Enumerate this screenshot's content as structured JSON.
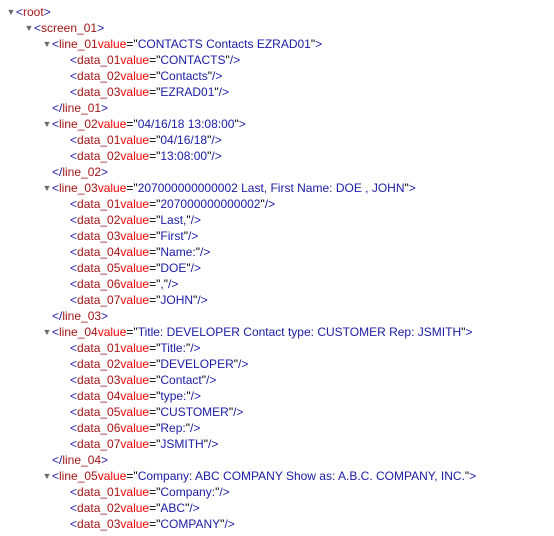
{
  "icons": {
    "open": "▼",
    "closed": "▶",
    "attr_sep": "="
  },
  "tree": [
    {
      "depth": 0,
      "twisty": "open",
      "kind": "open",
      "tag": "root"
    },
    {
      "depth": 1,
      "twisty": "open",
      "kind": "open",
      "tag": "screen_01"
    },
    {
      "depth": 2,
      "twisty": "open",
      "kind": "open",
      "tag": "line_01",
      "attr": "value",
      "val": " CONTACTS Contacts EZRAD01"
    },
    {
      "depth": 3,
      "twisty": "blank",
      "kind": "self",
      "tag": "data_01",
      "attr": "value",
      "val": "CONTACTS"
    },
    {
      "depth": 3,
      "twisty": "blank",
      "kind": "self",
      "tag": "data_02",
      "attr": "value",
      "val": "Contacts"
    },
    {
      "depth": 3,
      "twisty": "blank",
      "kind": "self",
      "tag": "data_03",
      "attr": "value",
      "val": "EZRAD01"
    },
    {
      "depth": 2,
      "twisty": "blank",
      "kind": "close",
      "tag": "line_01"
    },
    {
      "depth": 2,
      "twisty": "open",
      "kind": "open",
      "tag": "line_02",
      "attr": "value",
      "val": " 04/16/18 13:08:00"
    },
    {
      "depth": 3,
      "twisty": "blank",
      "kind": "self",
      "tag": "data_01",
      "attr": "value",
      "val": "04/16/18"
    },
    {
      "depth": 3,
      "twisty": "blank",
      "kind": "self",
      "tag": "data_02",
      "attr": "value",
      "val": "13:08:00"
    },
    {
      "depth": 2,
      "twisty": "blank",
      "kind": "close",
      "tag": "line_02"
    },
    {
      "depth": 2,
      "twisty": "open",
      "kind": "open",
      "tag": "line_03",
      "attr": "value",
      "val": " 207000000000002 Last, First Name: DOE , JOHN"
    },
    {
      "depth": 3,
      "twisty": "blank",
      "kind": "self",
      "tag": "data_01",
      "attr": "value",
      "val": "207000000000002"
    },
    {
      "depth": 3,
      "twisty": "blank",
      "kind": "self",
      "tag": "data_02",
      "attr": "value",
      "val": "Last,"
    },
    {
      "depth": 3,
      "twisty": "blank",
      "kind": "self",
      "tag": "data_03",
      "attr": "value",
      "val": "First"
    },
    {
      "depth": 3,
      "twisty": "blank",
      "kind": "self",
      "tag": "data_04",
      "attr": "value",
      "val": "Name:"
    },
    {
      "depth": 3,
      "twisty": "blank",
      "kind": "self",
      "tag": "data_05",
      "attr": "value",
      "val": "DOE"
    },
    {
      "depth": 3,
      "twisty": "blank",
      "kind": "self",
      "tag": "data_06",
      "attr": "value",
      "val": ","
    },
    {
      "depth": 3,
      "twisty": "blank",
      "kind": "self",
      "tag": "data_07",
      "attr": "value",
      "val": "JOHN"
    },
    {
      "depth": 2,
      "twisty": "blank",
      "kind": "close",
      "tag": "line_03"
    },
    {
      "depth": 2,
      "twisty": "open",
      "kind": "open",
      "tag": "line_04",
      "attr": "value",
      "val": " Title: DEVELOPER Contact type: CUSTOMER Rep: JSMITH"
    },
    {
      "depth": 3,
      "twisty": "blank",
      "kind": "self",
      "tag": "data_01",
      "attr": "value",
      "val": "Title:"
    },
    {
      "depth": 3,
      "twisty": "blank",
      "kind": "self",
      "tag": "data_02",
      "attr": "value",
      "val": "DEVELOPER"
    },
    {
      "depth": 3,
      "twisty": "blank",
      "kind": "self",
      "tag": "data_03",
      "attr": "value",
      "val": "Contact"
    },
    {
      "depth": 3,
      "twisty": "blank",
      "kind": "self",
      "tag": "data_04",
      "attr": "value",
      "val": "type:"
    },
    {
      "depth": 3,
      "twisty": "blank",
      "kind": "self",
      "tag": "data_05",
      "attr": "value",
      "val": "CUSTOMER"
    },
    {
      "depth": 3,
      "twisty": "blank",
      "kind": "self",
      "tag": "data_06",
      "attr": "value",
      "val": "Rep:"
    },
    {
      "depth": 3,
      "twisty": "blank",
      "kind": "self",
      "tag": "data_07",
      "attr": "value",
      "val": "JSMITH"
    },
    {
      "depth": 2,
      "twisty": "blank",
      "kind": "close",
      "tag": "line_04"
    },
    {
      "depth": 2,
      "twisty": "open",
      "kind": "open",
      "tag": "line_05",
      "attr": "value",
      "val": " Company: ABC COMPANY Show as: A.B.C. COMPANY, INC."
    },
    {
      "depth": 3,
      "twisty": "blank",
      "kind": "self",
      "tag": "data_01",
      "attr": "value",
      "val": "Company:"
    },
    {
      "depth": 3,
      "twisty": "blank",
      "kind": "self",
      "tag": "data_02",
      "attr": "value",
      "val": "ABC"
    },
    {
      "depth": 3,
      "twisty": "blank",
      "kind": "self",
      "tag": "data_03",
      "attr": "value",
      "val": "COMPANY"
    }
  ]
}
